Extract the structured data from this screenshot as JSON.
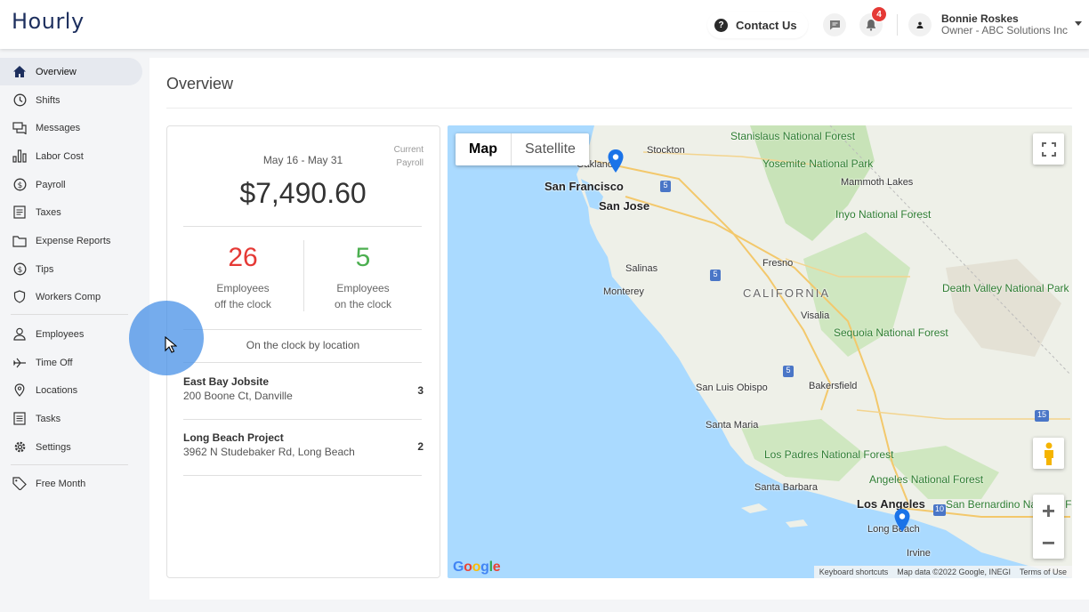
{
  "app": {
    "logo": "Hourly"
  },
  "header": {
    "contact_label": "Contact Us",
    "notification_count": "4",
    "user_name": "Bonnie Roskes",
    "user_role": "Owner - ABC Solutions Inc"
  },
  "sidebar": {
    "items": [
      {
        "label": "Overview",
        "icon": "home-icon",
        "active": true
      },
      {
        "label": "Shifts",
        "icon": "clock-icon"
      },
      {
        "label": "Messages",
        "icon": "messages-icon"
      },
      {
        "label": "Labor Cost",
        "icon": "bar-chart-icon"
      },
      {
        "label": "Payroll",
        "icon": "dollar-circle-icon"
      },
      {
        "label": "Taxes",
        "icon": "document-icon"
      },
      {
        "label": "Expense Reports",
        "icon": "folder-icon"
      },
      {
        "label": "Tips",
        "icon": "dollar-circle-icon"
      },
      {
        "label": "Workers Comp",
        "icon": "shield-icon"
      },
      {
        "label": "Employees",
        "icon": "person-icon"
      },
      {
        "label": "Time Off",
        "icon": "plane-icon"
      },
      {
        "label": "Locations",
        "icon": "location-pin-icon"
      },
      {
        "label": "Tasks",
        "icon": "list-icon"
      },
      {
        "label": "Settings",
        "icon": "gear-icon"
      },
      {
        "label": "Free Month",
        "icon": "tag-icon"
      }
    ]
  },
  "main": {
    "title": "Overview",
    "payroll": {
      "period": "May 16 - May 31",
      "current_label_1": "Current",
      "current_label_2": "Payroll",
      "amount": "$7,490.60"
    },
    "stats": {
      "off_count": "26",
      "off_label_1": "Employees",
      "off_label_2": "off the clock",
      "on_count": "5",
      "on_label_1": "Employees",
      "on_label_2": "on the clock"
    },
    "on_clock_title": "On the clock by location",
    "locations": [
      {
        "name": "East Bay Jobsite",
        "address": "200 Boone Ct, Danville",
        "count": "3"
      },
      {
        "name": "Long Beach Project",
        "address": "3962 N Studebaker Rd, Long Beach",
        "count": "2"
      }
    ]
  },
  "map": {
    "type_map": "Map",
    "type_satellite": "Satellite",
    "google": "Google",
    "attribution": [
      "Keyboard shortcuts",
      "Map data ©2022 Google, INEGI",
      "Terms of Use"
    ],
    "labels": {
      "stanislaus": "Stanislaus National Forest",
      "stockton": "Stockton",
      "oakland": "Oakland",
      "sf": "San Francisco",
      "yosemite": "Yosemite National Park",
      "mammoth": "Mammoth Lakes",
      "sanjose": "San Jose",
      "inyo": "Inyo National Forest",
      "salinas": "Salinas",
      "fresno": "Fresno",
      "monterey": "Monterey",
      "california": "CALIFORNIA",
      "deathvalley": "Death Valley National Park",
      "visalia": "Visalia",
      "sequoia": "Sequoia National Forest",
      "bakersfield": "Bakersfield",
      "sanluis": "San Luis Obispo",
      "santamaria": "Santa Maria",
      "lospadres": "Los Padres National Forest",
      "angeles": "Angeles National Forest",
      "santabarbara": "Santa Barbara",
      "losangeles": "Los Angeles",
      "sanbernardino": "San Bernardino National Forest",
      "longbeach": "Long Beach",
      "irvine": "Irvine",
      "hwy5": "5",
      "hwy5b": "5",
      "hwy5c": "5",
      "hwy15": "15",
      "hwy10": "10"
    }
  }
}
